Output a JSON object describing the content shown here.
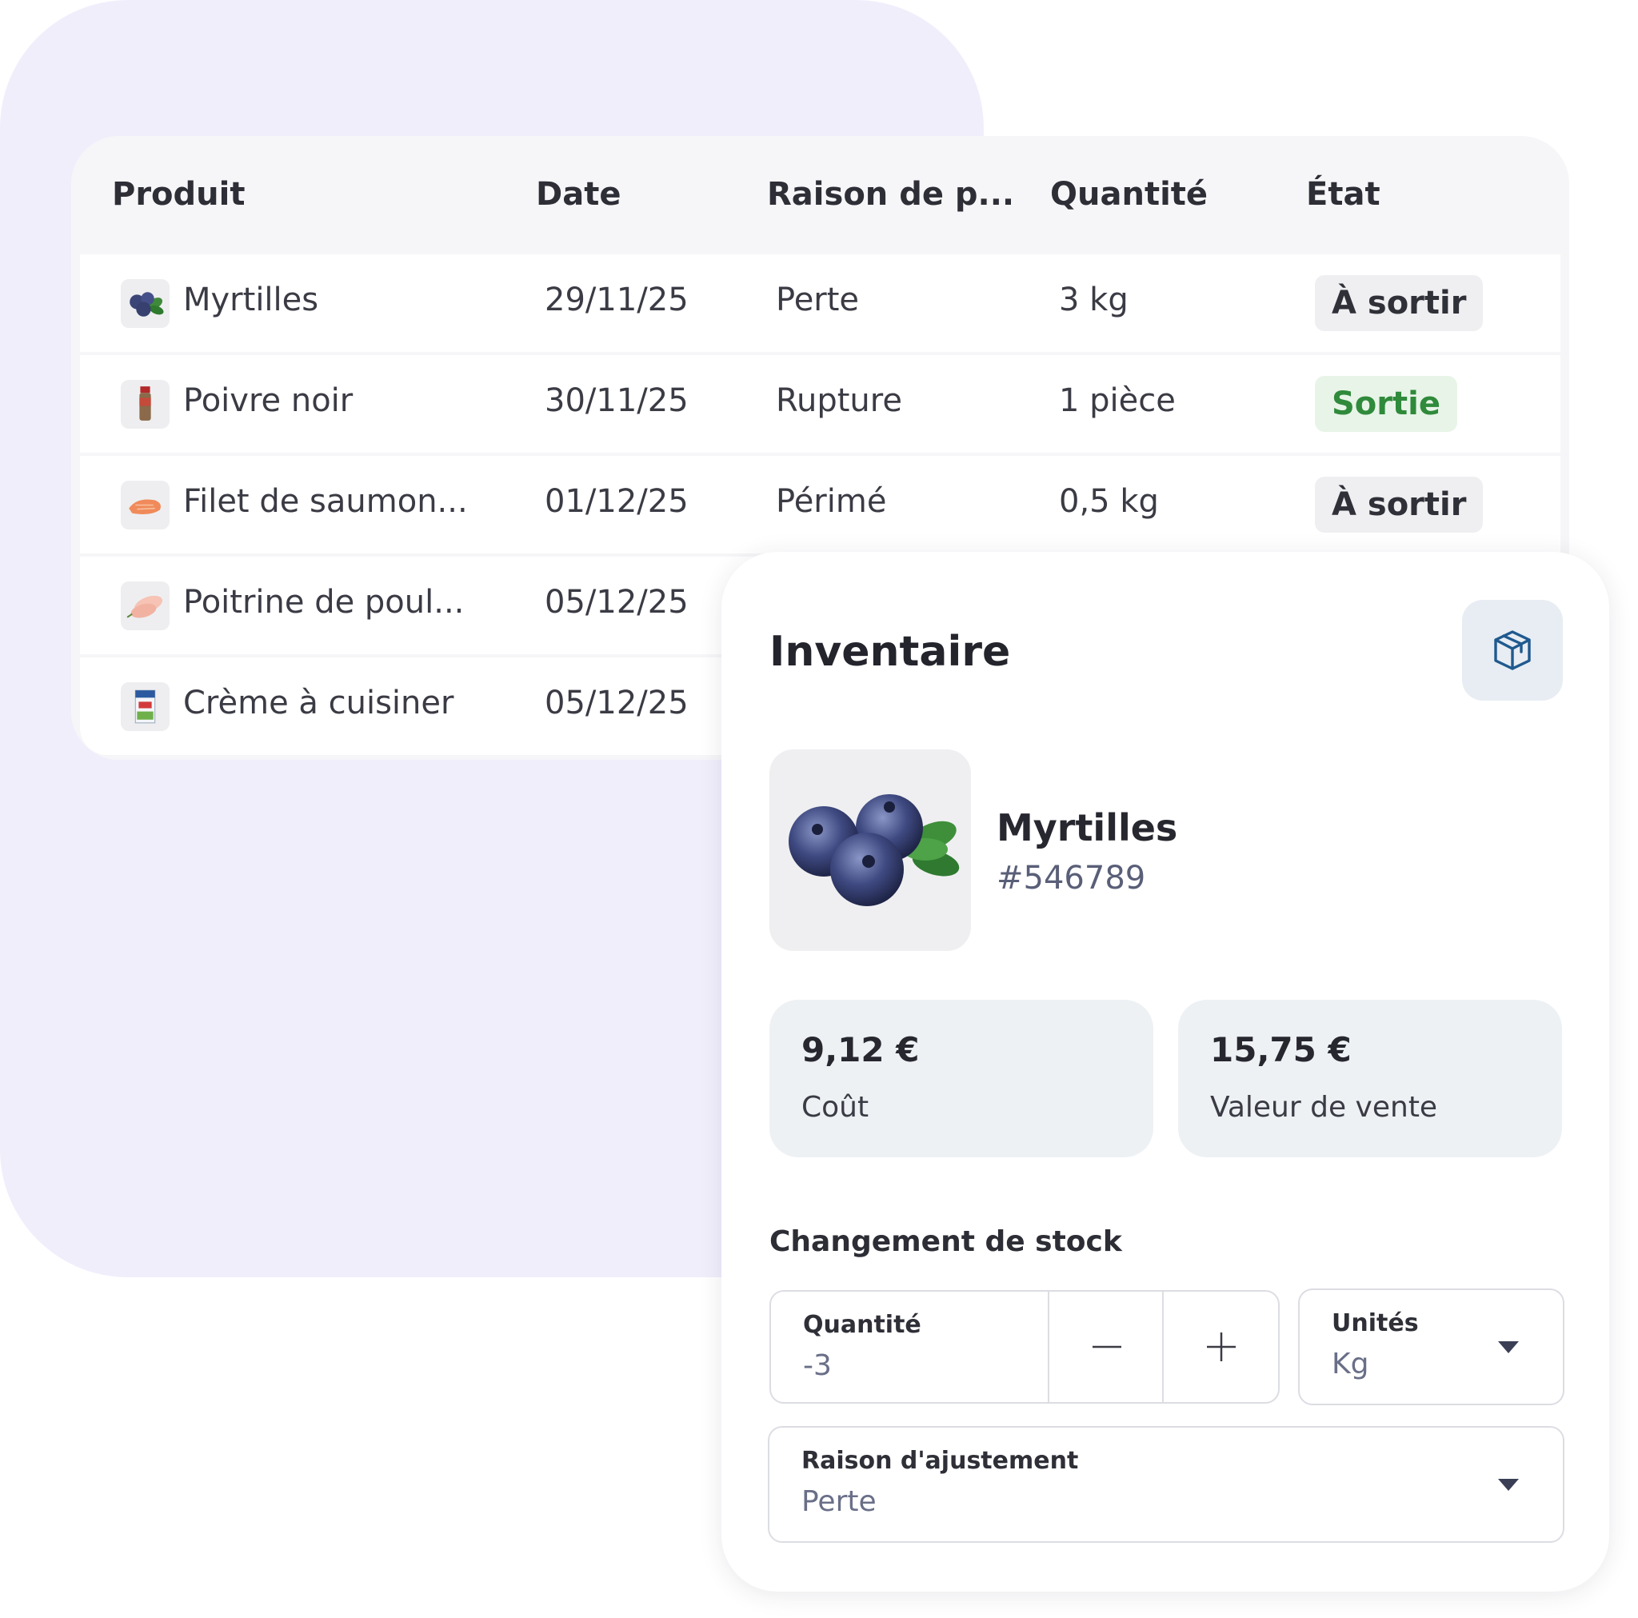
{
  "table": {
    "headers": {
      "product": "Produit",
      "date": "Date",
      "reason": "Raison de p...",
      "quantity": "Quantité",
      "state": "État"
    },
    "rows": [
      {
        "product": "Myrtilles",
        "icon": "blueberries-icon",
        "date": "29/11/25",
        "reason": "Perte",
        "quantity": "3 kg",
        "state": "À sortir",
        "state_type": "pending"
      },
      {
        "product": "Poivre noir",
        "icon": "pepper-jar-icon",
        "date": "30/11/25",
        "reason": "Rupture",
        "quantity": "1 pièce",
        "state": "Sortie",
        "state_type": "done"
      },
      {
        "product": "Filet de saumon...",
        "icon": "salmon-fillet-icon",
        "date": "01/12/25",
        "reason": "Périmé",
        "quantity": "0,5 kg",
        "state": "À sortir",
        "state_type": "pending"
      },
      {
        "product": "Poitrine de poul...",
        "icon": "chicken-breast-icon",
        "date": "05/12/25",
        "reason": "",
        "quantity": "",
        "state": "",
        "state_type": ""
      },
      {
        "product": "Crème à cuisiner",
        "icon": "cream-carton-icon",
        "date": "05/12/25",
        "reason": "",
        "quantity": "",
        "state": "",
        "state_type": ""
      }
    ]
  },
  "panel": {
    "title": "Inventaire",
    "action_icon": "box-icon",
    "product": {
      "name": "Myrtilles",
      "code": "#546789",
      "image_icon": "blueberries-image"
    },
    "stats": [
      {
        "value": "9,12 €",
        "label": "Coût"
      },
      {
        "value": "15,75 €",
        "label": "Valeur de vente"
      }
    ],
    "stock_change": {
      "section_label": "Changement de stock",
      "quantity": {
        "label": "Quantité",
        "value": "-3"
      },
      "units": {
        "label": "Unités",
        "value": "Kg"
      },
      "reason": {
        "label": "Raison d'ajustement",
        "value": "Perte"
      }
    }
  },
  "colors": {
    "background_blob": "#f1eefc",
    "badge_pending_bg": "#efeff1",
    "badge_done_bg": "#e8f4e8",
    "badge_done_text": "#2f8a3b",
    "stat_card_bg": "#eef1f4",
    "icon_accent": "#1f5a8f"
  }
}
